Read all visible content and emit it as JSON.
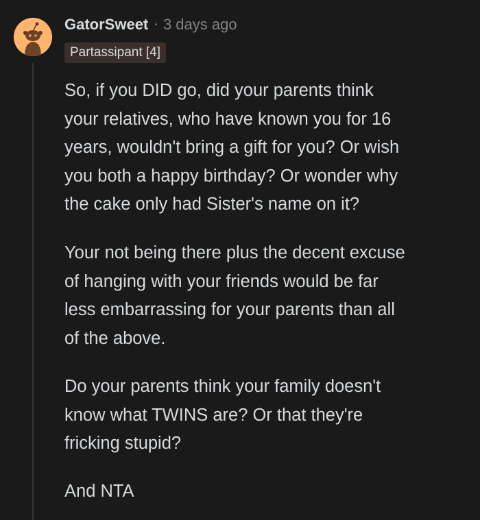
{
  "comment": {
    "author": "GatorSweet",
    "separator": "·",
    "timestamp": "3 days ago",
    "flair": "Partassipant [4]",
    "avatar_icon": "snoo-avatar-icon",
    "paragraphs": [
      "So, if you DID go, did your parents think\nyour relatives, who have known you for 16\nyears, wouldn't bring a gift for you? Or wish\nyou both a happy birthday? Or wonder why\nthe cake only had Sister's name on it?",
      "Your not being there plus the decent excuse\nof hanging with your friends would be far\nless embarrassing for your parents than all\nof the above.",
      "Do your parents think your family doesn't\nknow what TWINS are? Or that they're\nfricking stupid?",
      "And NTA"
    ]
  },
  "colors": {
    "background": "#1a1a1b",
    "text": "#d7dadc",
    "muted": "#818384",
    "flair_bg": "#3a2f2a",
    "avatar_bg": "#ffb56b",
    "thread_line": "#343536"
  }
}
